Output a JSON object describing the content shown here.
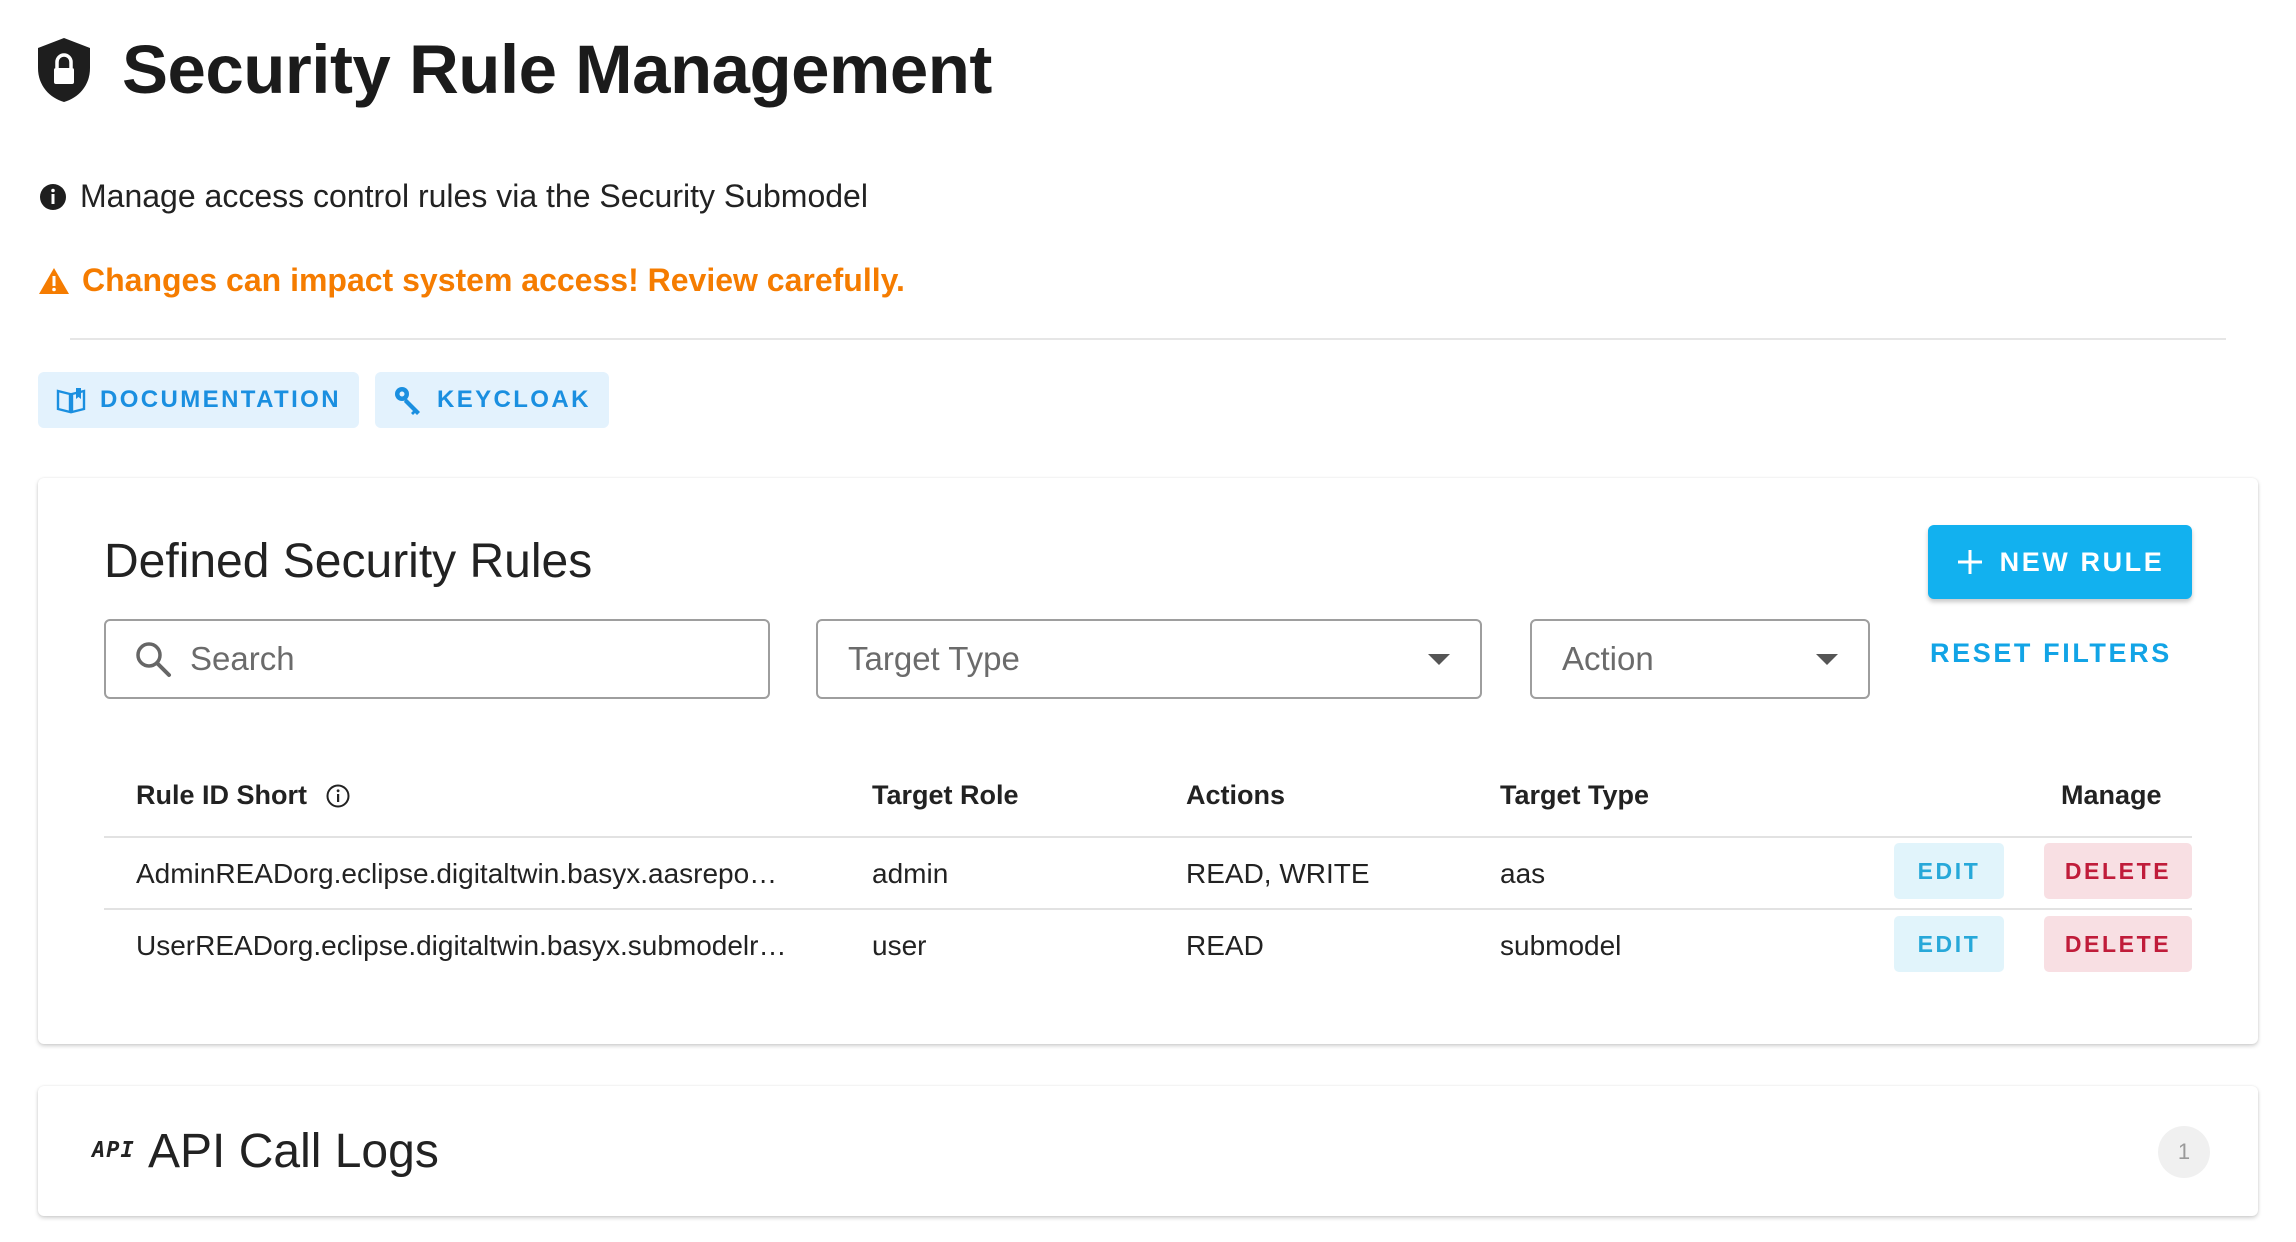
{
  "header": {
    "title": "Security Rule Management"
  },
  "info": {
    "text": "Manage access control rules via the Security Submodel"
  },
  "warning": {
    "text": "Changes can impact system access! Review carefully.",
    "color": "#f57c00"
  },
  "links": [
    {
      "label": "DOCUMENTATION",
      "icon": "book-icon"
    },
    {
      "label": "KEYCLOAK",
      "icon": "key-icon"
    }
  ],
  "rules_card": {
    "title": "Defined Security Rules",
    "new_rule_label": "NEW RULE",
    "search_placeholder": "Search",
    "target_type_label": "Target Type",
    "action_label": "Action",
    "reset_label": "RESET FILTERS",
    "columns": [
      "Rule ID Short",
      "Target Role",
      "Actions",
      "Target Type",
      "Manage"
    ],
    "rows": [
      {
        "id": "AdminREADorg.eclipse.digitaltwin.basyx.aasrepo…",
        "role": "admin",
        "actions": "READ, WRITE",
        "type": "aas"
      },
      {
        "id": "UserREADorg.eclipse.digitaltwin.basyx.submodelr…",
        "role": "user",
        "actions": "READ",
        "type": "submodel"
      }
    ],
    "edit_label": "EDIT",
    "delete_label": "DELETE"
  },
  "logs_card": {
    "icon_text": "API",
    "title": "API Call Logs",
    "badge": "1"
  },
  "colors": {
    "accent": "#12b1ef",
    "danger": "#c01c3a"
  }
}
